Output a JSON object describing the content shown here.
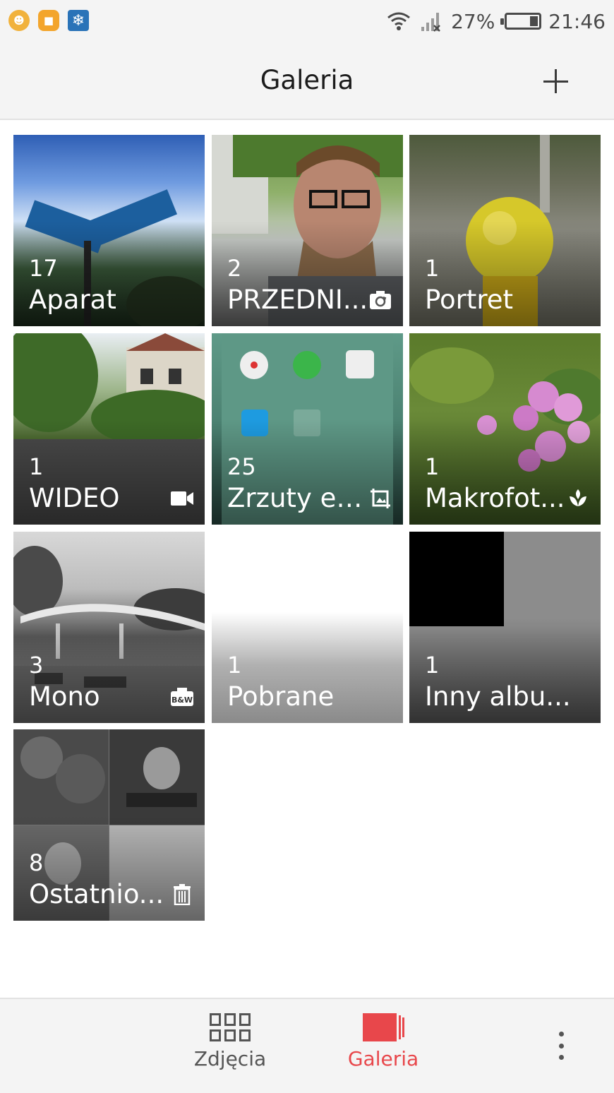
{
  "status_bar": {
    "battery": "27%",
    "battery_level": 0.27,
    "time": "21:46",
    "notification_icons": [
      "smile-icon",
      "app-icon",
      "snowflake-icon"
    ]
  },
  "header": {
    "title": "Galeria",
    "add_icon": "plus-icon"
  },
  "albums": [
    {
      "count": "17",
      "name": "Aparat",
      "badge": ""
    },
    {
      "count": "2",
      "name": "PRZEDNI...",
      "badge": "front-camera-icon"
    },
    {
      "count": "1",
      "name": "Portret",
      "badge": ""
    },
    {
      "count": "1",
      "name": "WIDEO",
      "badge": "video-icon"
    },
    {
      "count": "25",
      "name": "Zrzuty ek...",
      "badge": "screenshot-icon"
    },
    {
      "count": "1",
      "name": "Makrofot...",
      "badge": "macro-flower-icon"
    },
    {
      "count": "3",
      "name": "Mono",
      "badge": "bw-camera-icon"
    },
    {
      "count": "1",
      "name": "Pobrane",
      "badge": ""
    },
    {
      "count": "1",
      "name": "Inny albu...",
      "badge": ""
    },
    {
      "count": "8",
      "name": "Ostatnio...",
      "badge": "trash-icon"
    }
  ],
  "screenshot_badge_text": "B&W",
  "bottom_nav": {
    "photos_label": "Zdjęcia",
    "gallery_label": "Galeria",
    "active": "gallery",
    "active_color": "#e8474b"
  }
}
